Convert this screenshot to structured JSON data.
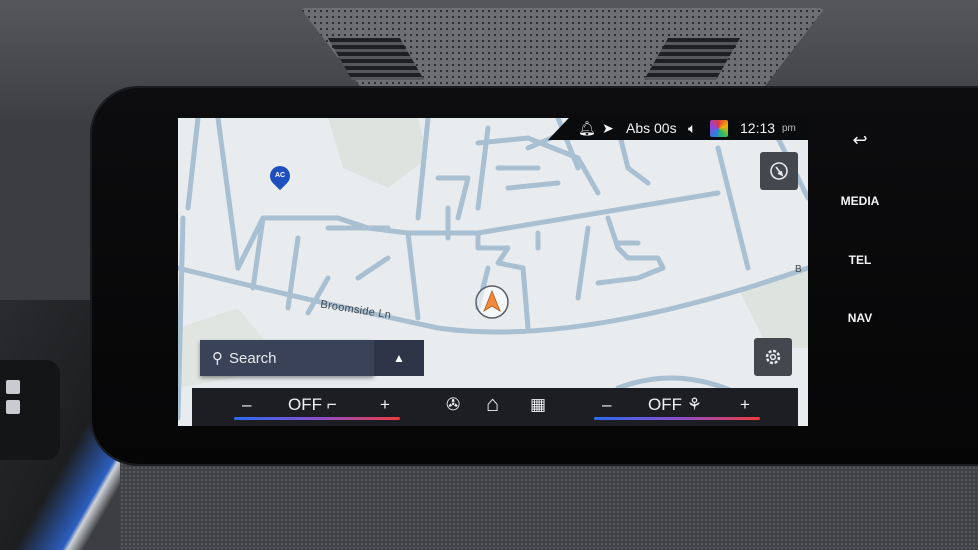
{
  "status_bar": {
    "bell_icon": "bell-icon",
    "nav_icon": "navigation-arrow-icon",
    "abs_label": "Abs 00s",
    "mute_icon": "speaker-mute-icon",
    "time": "12:13",
    "ampm": "pm"
  },
  "map": {
    "street_label": "Broomside Ln",
    "street_label_edge": "B",
    "poi_label": "AC"
  },
  "search": {
    "label": "Search",
    "toggle_icon": "▲"
  },
  "climate": {
    "left": {
      "minus": "–",
      "value": "OFF",
      "plus": "+"
    },
    "right": {
      "minus": "–",
      "value": "OFF",
      "plus": "+"
    },
    "fan_icon": "fan-icon",
    "home_icon": "home-icon",
    "apps_icon": "apps-grid-icon"
  },
  "hardkeys": {
    "back": "↩",
    "media": "MEDIA",
    "tel": "TEL",
    "nav": "NAV"
  },
  "colors": {
    "temp_cold": "#2a6cf0",
    "temp_hot": "#f03a3a",
    "search_bg": "#3a4258"
  }
}
